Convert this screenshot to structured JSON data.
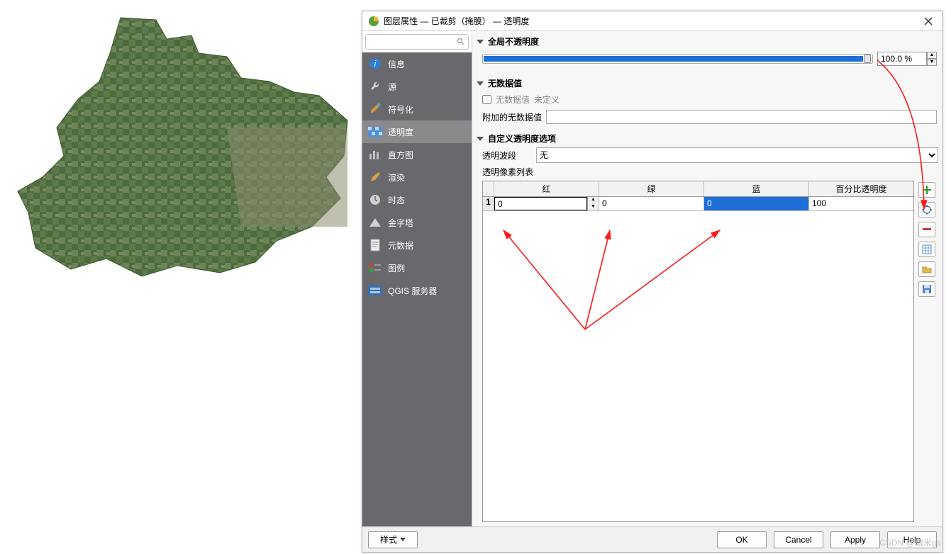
{
  "dialog": {
    "title": "图层属性 — 已裁剪（掩膜） — 透明度",
    "search_placeholder": ""
  },
  "nav": {
    "items": [
      "信息",
      "源",
      "符号化",
      "透明度",
      "直方图",
      "渲染",
      "时态",
      "金字塔",
      "元数据",
      "图例",
      "QGIS 服务器"
    ],
    "active_index": 3
  },
  "sections": {
    "opacity": {
      "title": "全局不透明度",
      "value": "100.0 %"
    },
    "nodata": {
      "title": "无数据值",
      "chk_label": "无数据值",
      "chk_hint": "未定义",
      "addl_label": "附加的无数据值",
      "addl_value": ""
    },
    "custom": {
      "title": "自定义透明度选项",
      "band_label": "透明波段",
      "band_value": "无",
      "list_label": "透明像素列表",
      "columns": [
        "红",
        "绿",
        "蓝",
        "百分比透明度"
      ],
      "rows": [
        {
          "n": "1",
          "r": "0",
          "g": "0",
          "b": "0",
          "pct": "100"
        }
      ]
    }
  },
  "footer": {
    "style": "样式",
    "ok": "OK",
    "cancel": "Cancel",
    "apply": "Apply",
    "help": "Help"
  },
  "watermark": "CSDN @糖米ga"
}
